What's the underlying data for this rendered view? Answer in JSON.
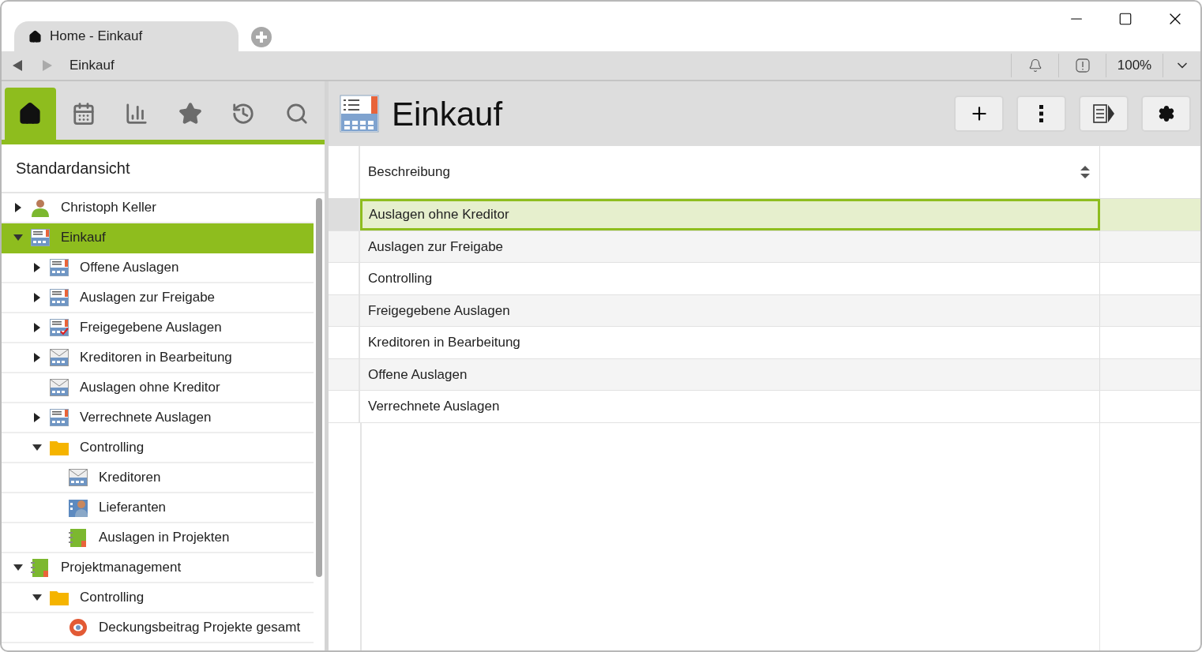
{
  "window": {
    "tab": {
      "title": "Home - Einkauf"
    }
  },
  "nav": {
    "breadcrumb": "Einkauf",
    "zoom": "100%"
  },
  "sidebar": {
    "tabs": [
      {
        "kind": "home",
        "selected": true
      },
      {
        "kind": "calendar",
        "selected": false
      },
      {
        "kind": "chart",
        "selected": false
      },
      {
        "kind": "favorites",
        "selected": false
      },
      {
        "kind": "history",
        "selected": false
      },
      {
        "kind": "search",
        "selected": false
      }
    ],
    "view_title": "Standardansicht",
    "tree": [
      {
        "label": "Christoph Keller",
        "kind": "person",
        "expanded": false,
        "selected": false
      },
      {
        "label": "Einkauf",
        "kind": "list",
        "expanded": true,
        "selected": true,
        "children": [
          {
            "label": "Offene Auslagen",
            "kind": "list",
            "expanded": false,
            "selected": false
          },
          {
            "label": "Auslagen zur Freigabe",
            "kind": "list",
            "expanded": false,
            "selected": false
          },
          {
            "label": "Freigegebene Auslagen",
            "kind": "approved",
            "expanded": false,
            "selected": false
          },
          {
            "label": "Kreditoren in Bearbeitung",
            "kind": "mail",
            "expanded": false,
            "selected": false
          },
          {
            "label": "Auslagen ohne Kreditor",
            "kind": "mail",
            "selected": false
          },
          {
            "label": "Verrechnete Auslagen",
            "kind": "list",
            "expanded": false,
            "selected": false
          },
          {
            "label": "Controlling",
            "kind": "folder",
            "expanded": true,
            "selected": false,
            "children": [
              {
                "label": "Kreditoren",
                "kind": "mail",
                "selected": false
              },
              {
                "label": "Lieferanten",
                "kind": "contact",
                "selected": false
              },
              {
                "label": "Auslagen in Projekten",
                "kind": "notebook",
                "selected": false
              }
            ]
          }
        ]
      },
      {
        "label": "Projektmanagement",
        "kind": "notebook",
        "expanded": true,
        "selected": false,
        "children": [
          {
            "label": "Controlling",
            "kind": "folder",
            "expanded": true,
            "selected": false,
            "children": [
              {
                "label": "Deckungsbeitrag Projekte gesamt",
                "kind": "target",
                "selected": false
              }
            ]
          }
        ]
      }
    ]
  },
  "main": {
    "title": "Einkauf",
    "table": {
      "columns": [
        "Beschreibung"
      ],
      "rows": [
        {
          "text": "Auslagen ohne Kreditor",
          "selected": true
        },
        {
          "text": "Auslagen zur Freigabe",
          "selected": false
        },
        {
          "text": "Controlling",
          "selected": false
        },
        {
          "text": "Freigegebene Auslagen",
          "selected": false
        },
        {
          "text": "Kreditoren in Bearbeitung",
          "selected": false
        },
        {
          "text": "Offene Auslagen",
          "selected": false
        },
        {
          "text": "Verrechnete Auslagen",
          "selected": false
        }
      ]
    }
  }
}
